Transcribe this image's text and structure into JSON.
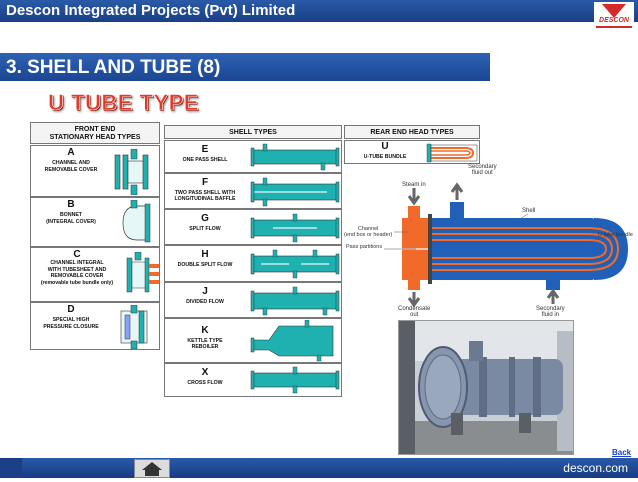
{
  "header": {
    "company": "Descon Integrated Projects (Pvt) Limited",
    "logo_text": "DESCON"
  },
  "section": {
    "title": "3. SHELL AND TUBE (8)"
  },
  "subtitle": "U TUBE TYPE",
  "table": {
    "front_end_header": "FRONT END\nSTATIONARY HEAD TYPES",
    "shell_header": "SHELL TYPES",
    "rear_header": "REAR END HEAD TYPES",
    "front_types": [
      {
        "code": "A",
        "desc": "CHANNEL AND\nREMOVABLE COVER"
      },
      {
        "code": "B",
        "desc": "BONNET\n(INTEGRAL COVER)"
      },
      {
        "code": "C",
        "desc": "CHANNEL INTEGRAL\nWITH TUBESHEET AND\nREMOVABLE COVER\n(removable tube bundle only)"
      },
      {
        "code": "D",
        "desc": "SPECIAL HIGH\nPRESSURE CLOSURE"
      }
    ],
    "shell_types": [
      {
        "code": "E",
        "desc": "ONE PASS SHELL"
      },
      {
        "code": "F",
        "desc": "TWO PASS SHELL WITH\nLONGITUDINAL BAFFLE"
      },
      {
        "code": "G",
        "desc": "SPLIT FLOW"
      },
      {
        "code": "H",
        "desc": "DOUBLE SPLIT FLOW"
      },
      {
        "code": "J",
        "desc": "DIVIDED FLOW"
      },
      {
        "code": "K",
        "desc": "KETTLE TYPE\nREBOILER"
      },
      {
        "code": "X",
        "desc": "CROSS FLOW"
      }
    ],
    "rear_types": [
      {
        "code": "U",
        "desc": "U-TUBE BUNDLE"
      }
    ]
  },
  "diagram": {
    "labels": {
      "steam_in": "Steam in",
      "secondary_fluid_out": "Secondary\nfluid out",
      "shell": "Shell",
      "u_tube_bundle": "U tube bundle",
      "channel": "Channel\n(end box or header)",
      "pass_partitions": "Pass partitions",
      "condensate_out": "Condensate\nout",
      "secondary_fluid_in": "Secondary\nfluid in"
    }
  },
  "footer": {
    "back_label": "Back",
    "site": "descon.com",
    "home_icon": "home-icon"
  },
  "colors": {
    "header_blue": "#1f4c9c",
    "shell_blue": "#1e5fb0",
    "channel_orange": "#f26a2a",
    "title_red": "#e03a2a",
    "teal": "#1fb0b0"
  }
}
